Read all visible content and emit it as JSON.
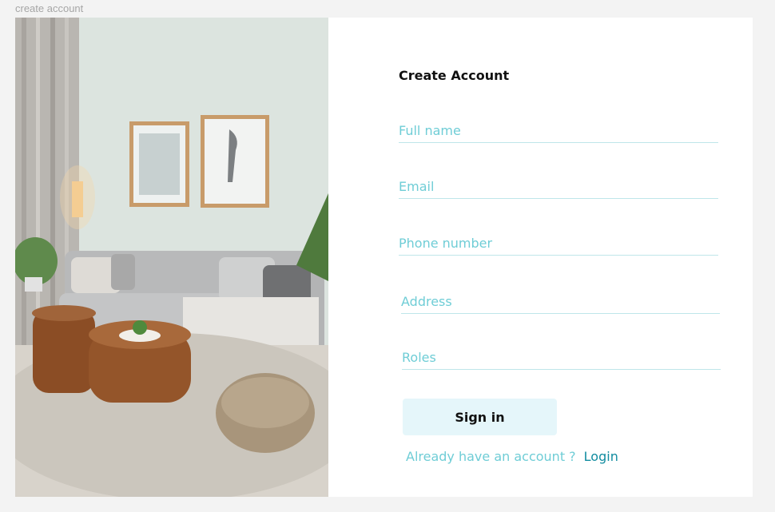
{
  "frame_label": "create account",
  "form": {
    "title": "Create Account",
    "fields": {
      "full_name": {
        "placeholder": "Full name"
      },
      "email": {
        "placeholder": "Email"
      },
      "phone": {
        "placeholder": "Phone number"
      },
      "address": {
        "placeholder": "Address"
      },
      "roles": {
        "placeholder": "Roles"
      }
    },
    "sign_in_label": "Sign in",
    "already_text": "Already have an  account ?",
    "login_label": "Login"
  },
  "colors": {
    "accent_text": "#6fcdd6",
    "link": "#118ca0",
    "button_bg": "#e5f6fa",
    "underline": "#bfe6ea"
  }
}
